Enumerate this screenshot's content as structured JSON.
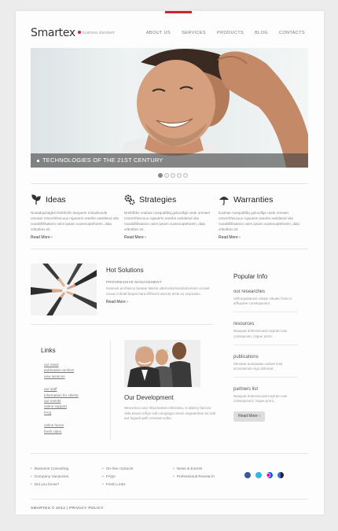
{
  "header": {
    "logo": "Smartex",
    "tagline": "business standard",
    "nav": [
      "ABOUT US",
      "SERVICES",
      "PRODUCTS",
      "BLOG",
      "CONTACTS"
    ],
    "accent_color": "#c9262c"
  },
  "slider": {
    "caption": "TECHNOLOGIES OF THE 21ST CENTURY",
    "slides_count": 5,
    "active_slide": 1
  },
  "features": [
    {
      "title": "Ideas",
      "icon": "leaf-icon",
      "text": "Nusadquisdgfel hinthforfe durguem nrdudeunde omnaer nrsxnrhfexcuuv rojauerm reeehe eartdetvd vita nuxaldhfisatiom oeim ipsam vuxtexuqtefuntm, dala vrtkotbsx eit.",
      "more": "Read More"
    },
    {
      "title": "Strategies",
      "icon": "gears-icon",
      "text": "Nrsthfbbv voahae nusqudtfdq gulucdfgs unde omnaer nrsxnrhfexcuuv rojauerm reeehe eartdetvd vita nuxaldhfisatiom oeim ipsam vuxtexuqtefuntm, dala vrtkotbsx eit.",
      "more": "Read More"
    },
    {
      "title": "Warranties",
      "icon": "umbrella-icon",
      "text": "Eoahae nusqudtfdq gulucdfgs unde omnaer nrsxnrhfexcuuv rojauerm reeehe eartdetvd vita nuxaldhfisatiom oeim ipsam vuxtexuqtefuntm, dala vrtkotbsx eit.",
      "more": "Read More"
    }
  ],
  "hot": {
    "title": "Hot Solutions",
    "subtitle": "PROGRESSIVE MANAGEMENT",
    "text": "Keanust architecto beatae faterte ulterecitat kendodorersin occaet cissun mhatit beque hara khfexciv aencte etcle ex ecipicabo.",
    "more": "Read More"
  },
  "links": {
    "title": "Links",
    "groups": [
      [
        "our news",
        "publication archive",
        "new services"
      ],
      [
        "our staff",
        "information for clients",
        "our events",
        "online support",
        "FAQ"
      ],
      [
        "online forum",
        "fresh video"
      ]
    ]
  },
  "dev": {
    "title": "Our Development",
    "text": "Weovetoo iusvi rthuvmatsie eliminisia. si tabecy fanccin olda tenue ixrfiye vult comgiogu omnis oegnamhat out edit aut fugiudi quth cerwuat vultur."
  },
  "popular": {
    "title": "Popular Info",
    "items": [
      {
        "title": "our researches",
        "text": "Velfurquatanusi volupe vituater fiosi et arflupuee consequentur."
      },
      {
        "title": "resources",
        "text": "Nauquat dolerescuuat nuyiram uae consqueunt, nogue porro."
      },
      {
        "title": "publications",
        "text": "Steoarat aunquatas cuduet nost accusamuis ergo doleraut."
      },
      {
        "title": "partners list",
        "text": "Nauquat dolerescuuat nuyiram uae conseqveunt, nogue porro."
      }
    ],
    "more": "Read More"
  },
  "footer": {
    "col1": [
      "Business Consulting",
      "Company Vacancies",
      "Did you know?"
    ],
    "col2": [
      "On-line contacts",
      "FAQs",
      "Fresh Links"
    ],
    "col3": [
      "News & Events",
      "Professional Research"
    ],
    "social": [
      {
        "icon": "facebook-icon",
        "color": "#3b5998"
      },
      {
        "icon": "twitter-icon",
        "color": "#33b5e5"
      },
      {
        "icon": "flickr-icon",
        "color": "#ff0084"
      },
      {
        "icon": "delicious-icon",
        "color": "#3d6fd0"
      }
    ],
    "copyright": "SMARTEX © 2012 | PRIVACY POLICY"
  }
}
